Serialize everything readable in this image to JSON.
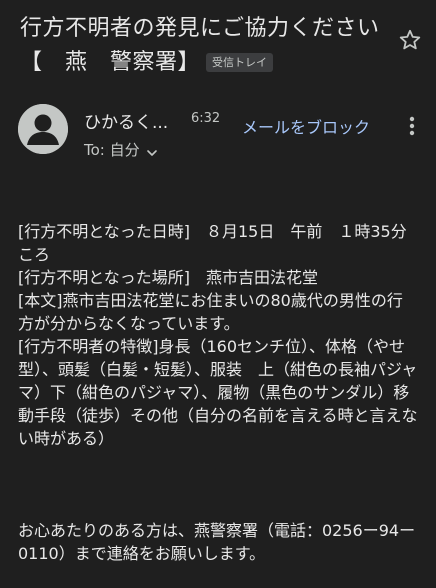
{
  "subject": {
    "title": "行方不明者の発見にご協力ください【　燕　警察署】",
    "label_chip": "受信トレイ"
  },
  "icons": {
    "star": "star-icon",
    "avatar": "person-icon",
    "more": "more-vert-icon",
    "chevron": "chevron-down-icon"
  },
  "sender": {
    "name": "ひかるく...",
    "time": "6:32",
    "block_link": "メールをブロック",
    "to_label": "To: 自分"
  },
  "body": {
    "paragraph1": "[行方不明となった日時]　８月15日　午前　１時35分ころ\n[行方不明となった場所]　燕市吉田法花堂\n[本文]燕市吉田法花堂にお住まいの80歳代の男性の行方が分からなくなっています。\n[行方不明者の特徴]身長（160センチ位）、体格（やせ型）、頭髪（白髪・短髪）、服装　上（紺色の長袖パジャマ）下（紺色のパジャマ）、履物（黒色のサンダル）移動手段（徒歩）その他（自分の名前を言える時と言えない時がある）",
    "paragraph2": "お心あたりのある方は、燕警察署（電話：0256ー94ー0110）まで連絡をお願いします。"
  },
  "colors": {
    "background": "#1f1f1f",
    "text": "#e8e8e8",
    "secondary_text": "#c4c7c5",
    "link": "#a8c7fa",
    "chip_bg": "#3c3d3f",
    "avatar_bg": "#c4c7c5"
  }
}
